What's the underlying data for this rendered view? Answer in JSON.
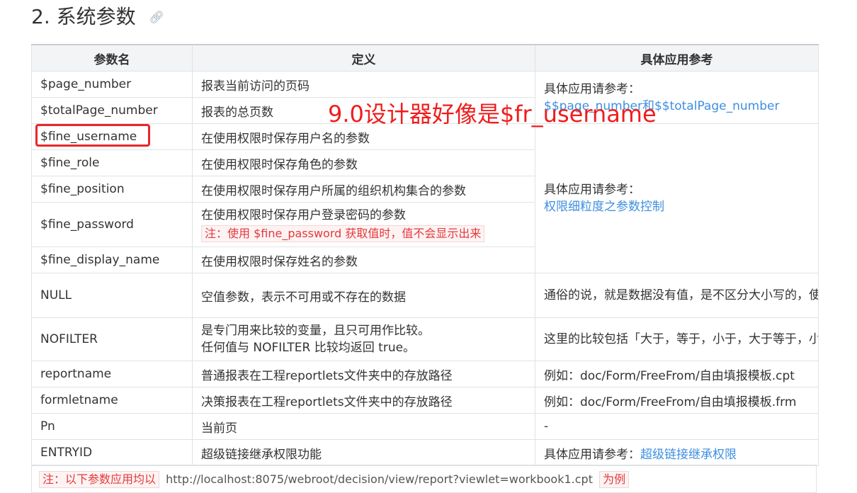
{
  "heading": {
    "number": "2.",
    "title": "系统参数",
    "anchor_icon": "link-icon"
  },
  "table": {
    "headers": [
      "参数名",
      "定义",
      "具体应用参考"
    ],
    "rows": [
      {
        "name": "$page_number",
        "definition": "报表当前访问的页码"
      },
      {
        "name": "$totalPage_number",
        "definition": "报表的总页数"
      },
      {
        "name": "$fine_username",
        "definition": "在使用权限时保存用户名的参数"
      },
      {
        "name": "$fine_role",
        "definition": "在使用权限时保存角色的参数"
      },
      {
        "name": "$fine_position",
        "definition": "在使用权限时保存用户所属的组织机构集合的参数"
      },
      {
        "name": "$fine_password",
        "definition": "在使用权限时保存用户登录密码的参数",
        "note": "注：使用 $fine_password 获取值时，值不会显示出来"
      },
      {
        "name": "$fine_display_name",
        "definition": "在使用权限时保存姓名的参数"
      },
      {
        "name": "NULL",
        "definition": "空值参数，表示不可用或不存在的数据",
        "reference": "通俗的说，就是数据没有值，是不区分大小写的，使用范围广泛"
      },
      {
        "name": "NOFILTER",
        "definition_line1": "是专门用来比较的变量，且只可用作比较。",
        "definition_line2": "任何值与 NOFILTER 比较均返回 true。",
        "reference": "这里的比较包括「大于，等于，小于，大于等于，小于等于」等等，不区分大小写"
      },
      {
        "name": "reportname",
        "definition": "普通报表在工程reportlets文件夹中的存放路径",
        "reference": "例如：doc/Form/FreeFrom/自由填报模板.cpt"
      },
      {
        "name": "formletname",
        "definition": "决策报表在工程reportlets文件夹中的存放路径",
        "reference": "例如：doc/Form/FreeFrom/自由填报模板.frm"
      },
      {
        "name": "Pn",
        "definition": "当前页",
        "reference": "-"
      },
      {
        "name": "ENTRYID",
        "definition": "超级链接继承权限功能",
        "reference_prefix": "具体应用请参考：",
        "reference_link": "超级链接继承权限"
      }
    ],
    "ref_group1": {
      "prefix": "具体应用请参考：",
      "link": "$$page_number和$$totalPage_number"
    },
    "ref_group2": {
      "prefix": "具体应用请参考：",
      "link": "权限细粒度之参数控制"
    }
  },
  "footer": {
    "note_prefix": "注：以下参数应用均以",
    "url": "http://localhost:8075/webroot/decision/view/report?viewlet=workbook1.cpt",
    "note_suffix": "为例"
  },
  "annotation": {
    "text": "9.0设计器好像是$fr_username",
    "color": "#f01c1c"
  }
}
